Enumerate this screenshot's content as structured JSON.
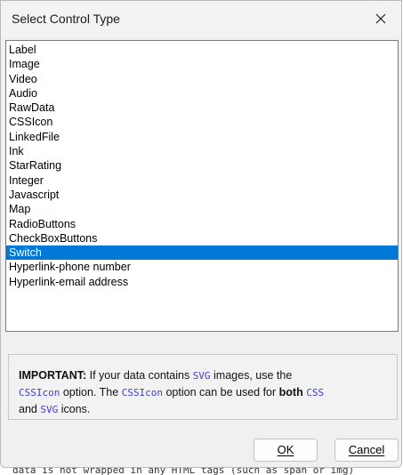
{
  "backdrop": {
    "text": "data is not wrapped in any HTML tags (such as span or img)"
  },
  "dialog": {
    "title": "Select Control Type",
    "close_icon": "close-icon"
  },
  "list": {
    "items": [
      "Label",
      "Image",
      "Video",
      "Audio",
      "RawData",
      "CSSIcon",
      "LinkedFile",
      "Ink",
      "StarRating",
      "Integer",
      "Javascript",
      "Map",
      "RadioButtons",
      "CheckBoxButtons",
      "Switch",
      "Hyperlink-phone number",
      "Hyperlink-email address"
    ],
    "selected": "Switch"
  },
  "info": {
    "important": "IMPORTANT:",
    "t1": " If your data contains ",
    "svg1": "SVG",
    "t2": " images, use the ",
    "cssicon1": "CSSIcon",
    "t3": " option. The ",
    "cssicon2": "CSSIcon",
    "t4": " option can be used for ",
    "both": "both",
    "t5": " ",
    "css": "CSS",
    "t6": "and ",
    "svg2": "SVG",
    "t7": " icons."
  },
  "buttons": {
    "ok": "OK",
    "cancel": "Cancel"
  },
  "colors": {
    "selection": "#0078d7",
    "code": "#3f3fcc"
  }
}
